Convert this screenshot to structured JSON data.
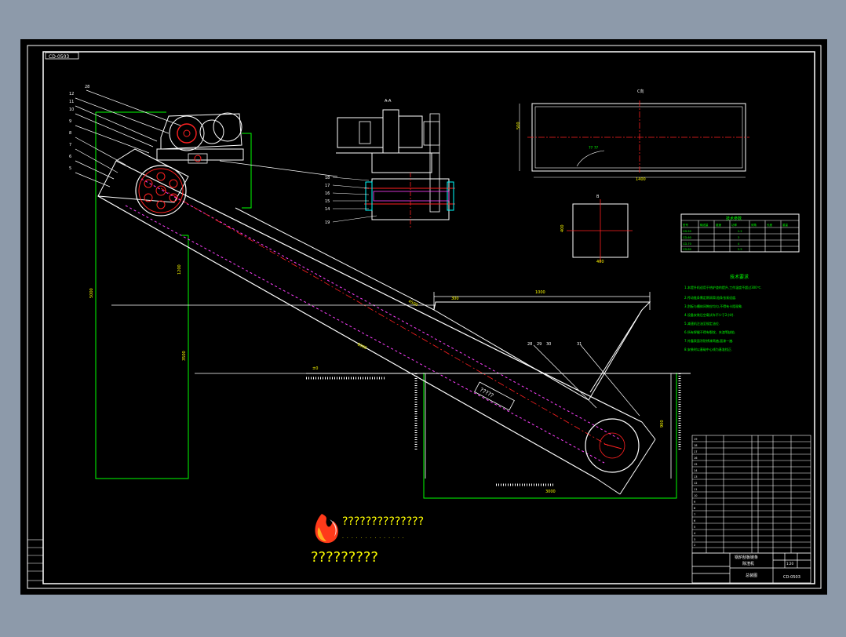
{
  "drawing": {
    "code_top_left": "CD-0503",
    "logo_text_line1": "??????????????",
    "logo_text_line2": "?????????",
    "tech_title": "技术要求",
    "tech_lines": [
      "1.本提升机适用于热炉渣的提升,工作温度不超过300℃.",
      "2.传动链条需定期润滑,链条张紧适度.",
      "3.刮板与槽体间隙应均匀,不得有卡阻现象.",
      "4.设备安装后空载试车不少于2小时.",
      "5.减速机注油至规定油位.",
      "6.所有焊缝不得有裂纹、夹渣等缺陷.",
      "7.外露表面涂防锈漆两遍,面漆一遍.",
      "8.安装时以基础中心线为基准找正."
    ],
    "param_table_title": "技术参数",
    "view_c_label": "C向",
    "view_aa_label": "A-A",
    "view_b_label": "B",
    "title_block": {
      "name_line1": "锅炉刮板链条",
      "name_line2": "除渣机",
      "drawing_no": "CD-0503",
      "scale": "1:20",
      "sheet": "总装图"
    }
  },
  "colors": {
    "frame": "#ffffff",
    "green": "#00ff00",
    "yellow": "#ffff00",
    "red": "#ff2020",
    "magenta": "#ff40ff",
    "cyan": "#00ffff",
    "background": "#000000"
  }
}
